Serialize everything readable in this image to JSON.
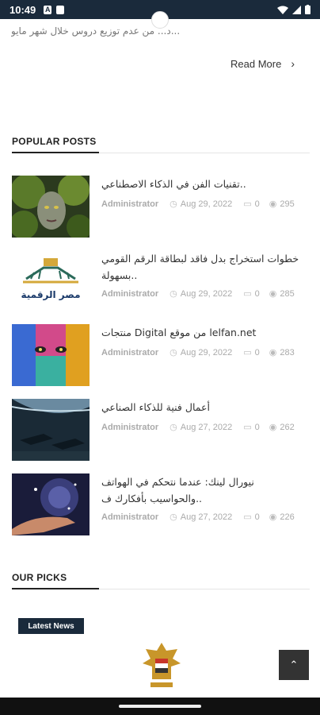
{
  "status_bar": {
    "time": "10:49",
    "notif_a": "A"
  },
  "excerpt": {
    "text": "...د... من عدم توزيع دروس خلال شهر مايو"
  },
  "read_more": {
    "label": "Read More",
    "chevron": "›"
  },
  "popular": {
    "heading": "POPULAR POSTS",
    "posts": [
      {
        "title": "تقنيات الفن في الذكاء الاصطناعي..",
        "author": "Administrator",
        "date": "Aug 29, 2022",
        "comments": "0",
        "views": "295"
      },
      {
        "title": "خطوات استخراج بدل فاقد لبطاقة الرقم القومي بسهولة..",
        "author": "Administrator",
        "date": "Aug 29, 2022",
        "comments": "0",
        "views": "285"
      },
      {
        "title": "منتجات Digital من موقع lelfan.net",
        "author": "Administrator",
        "date": "Aug 29, 2022",
        "comments": "0",
        "views": "283"
      },
      {
        "title": "أعمال فنية للذكاء الصناعي",
        "author": "Administrator",
        "date": "Aug 27, 2022",
        "comments": "0",
        "views": "262"
      },
      {
        "title": "نيورال لينك: عندما نتحكم في الهواتف والحواسيب بأفكارك ف..",
        "author": "Administrator",
        "date": "Aug 27, 2022",
        "comments": "0",
        "views": "226"
      }
    ]
  },
  "picks": {
    "heading": "OUR PICKS",
    "badge": "Latest News"
  },
  "thumb2_logo_text": "مصر الرقمية",
  "scroll_top": {
    "icon": "chevron-up-icon",
    "glyph": "⌃"
  },
  "colors": {
    "navy": "#1a2a3b",
    "meta_gray": "#aaaaaa"
  }
}
